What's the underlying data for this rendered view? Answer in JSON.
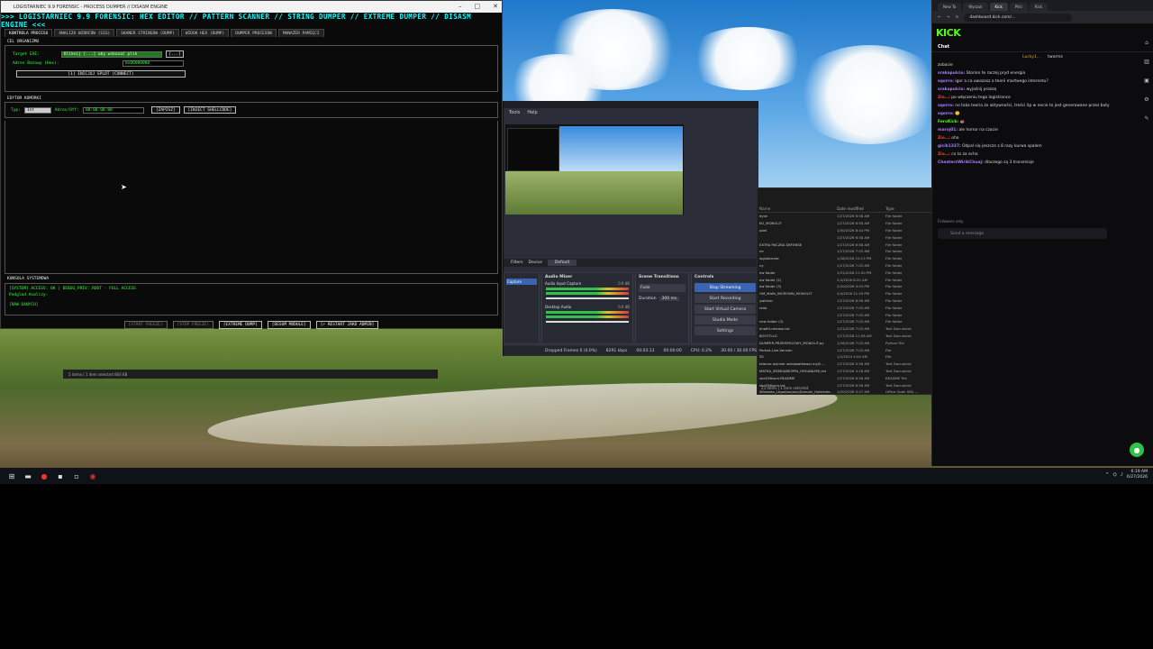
{
  "forensic": {
    "window_title": "LOGISTARNIEC 9.9 FORENSIC - PROCESS DUMPER // DISASM ENGINE",
    "header": ">>> LOGISTARNIEC 9.9 FORENSIC: HEX EDITOR // PATTERN SCANNER // STRING DUMPER // EXTREME DUMPER // DISASM ENGINE <<<",
    "tabs": [
      "KONTROLA PROCESU",
      "ANALIZA WZORCÓW (SIG)",
      "SKANER STRINGÓW (DUMP)",
      "WIDOK HEX (DUMP)",
      "DUMPER PROCESÓW",
      "MANAŻER PAMIĘCI"
    ],
    "target_section": "CEL ORGANIZMU",
    "target_label": "Target EXE:",
    "target_value": "Kliknij [...] aby wskazać plik",
    "browse_btn": "[...]",
    "base_label": "Adres Bazowy (Hex):",
    "base_value": "0x00000000",
    "connect_btn": "[1] INICJUJ SPLOT (CONNECT)",
    "editor_section": "EDYTOR KOMÓRKI",
    "type_label": "Typ:",
    "type_value": "Int",
    "address_label": "Adres/Off:",
    "address_value": "00:00:00:00",
    "write_btn": "[ZAPISZ]",
    "inject_btn": "[INJECT SHELLCODE]",
    "console_section": "KONSOLA SYSTEMOWA",
    "console_lines": [
      "[SYSTEM] ACCESS: OK | DEBUG_PRIV: ROOT - FULL ACCESS",
      "Podglad Analizy:",
      "[RAW DANYCH]"
    ],
    "bottom_buttons": [
      "[START FREEZE]",
      "[STOP FREEZE]",
      "[EXTREME DUMP]",
      "[DESUM MODULE]",
      "[⚡ RESTART JAKO ADMIN]"
    ]
  },
  "obs": {
    "menu": [
      "Tools",
      "Help"
    ],
    "filters": "Filters",
    "device": "Device",
    "default": "Default",
    "mixer_title": "Audio Mixer",
    "mixer_ch1": "Audio Input Capture",
    "mixer_ch2": "Desktop Audio",
    "level1": "0.0 dB",
    "level2": "0.0 dB",
    "transitions_title": "Scene Transitions",
    "transition": "Fade",
    "duration_label": "Duration",
    "duration": "300 ms",
    "controls_title": "Controls",
    "controls": [
      "Stop Streaming",
      "Start Recording",
      "Start Virtual Camera",
      "Studio Mode",
      "Settings"
    ],
    "status": [
      "Dropped Frames 0 (0.0%)",
      "8291 kbps",
      "00:03:13",
      "00:00:00",
      "CPU: 0.2%",
      "30.00 / 30.00 FPS"
    ]
  },
  "files": {
    "headers": [
      "Name",
      "Date modified",
      "Type"
    ],
    "rows": [
      [
        "dysk",
        "1/27/2026 6:58 AM",
        "File folder"
      ],
      [
        "KO_MONOLIT",
        "1/27/2026 6:58 AM",
        "File folder"
      ],
      [
        "ozet",
        "1/30/2026 8:44 PM",
        "File folder"
      ],
      [
        "",
        "1/27/2026 6:58 AM",
        "File folder"
      ],
      [
        "EXTRA PACZKA DEFENSE",
        "1/27/2026 6:58 AM",
        "File folder"
      ],
      [
        "ne",
        "1/27/2026 7:03 AM",
        "File folder"
      ],
      [
        "logistarniec",
        "1/18/2026 10:13 PM",
        "File folder"
      ],
      [
        "ny",
        "1/27/2026 7:03 AM",
        "File folder"
      ],
      [
        "ew folder",
        "1/31/2026 11:50 PM",
        "File folder"
      ],
      [
        "ew folder (2)",
        "2/4/2026 8:20 AM",
        "File folder"
      ],
      [
        "ew folder (3)",
        "2/20/2026 5:03 PM",
        "File folder"
      ],
      [
        "OM_MAIN_INCROWN_MONOLIT",
        "2/4/2026 11:16 PM",
        "File folder"
      ],
      [
        "ywilmer",
        "1/27/2026 6:56 AM",
        "File folder"
      ],
      [
        "rella",
        "1/27/2026 7:03 AM",
        "File folder"
      ],
      [
        "",
        "1/27/2026 7:03 AM",
        "File folder"
      ],
      [
        "new folder (3)",
        "1/27/2026 7:03 AM",
        "File folder"
      ],
      [
        "ima64-release.txt",
        "1/21/2026 7:03 AM",
        "Text Document"
      ],
      [
        "BOOTO.LG",
        "1/17/2026 11:58 AM",
        "Text Document"
      ],
      [
        "DUMPER-PRZEMYSLOWY_MONOLIT.py",
        "1/26/2026 7:03 AM",
        "Python File"
      ],
      [
        "Parted-Live-Version",
        "1/27/2026 7:03 AM",
        "File"
      ],
      [
        "SS",
        "1/1/2024 4:04 AM",
        "File"
      ],
      [
        "telecze wymiar wielowatkowej mylil ...",
        "1/27/2026 5:56 AM",
        "Text Document"
      ],
      [
        "MATKA_ZIEMIA(BEZPIN_ORGANIZM).txt",
        "1/27/2026 4:18 AM",
        "Text Document"
      ],
      [
        "sha256sum.README",
        "1/27/2026 6:56 AM",
        "README File"
      ],
      [
        "sha256sum.txt",
        "1/27/2026 6:56 AM",
        "Text Document"
      ],
      [
        "Windows_LegalizacjanyDomaIn_Holender...",
        "1/20/2026 5:47 AM",
        "Office Open XML ..."
      ]
    ],
    "footer": "23 items  |  1 item selected"
  },
  "explorer_strip": "5 items  |  1 item selected  804 KB",
  "chrome": {
    "tabs": [
      "New Ta",
      "Wyszuk",
      "Kick",
      "Pliki",
      "Kick"
    ],
    "url": "dashboard.kick.com/...",
    "logo": "KICK",
    "chat_title": "Chat",
    "top_users": [
      "Lucky1...",
      "tworms"
    ],
    "messages": [
      {
        "user": "",
        "text": "zobacie",
        "color": "#ccc"
      },
      {
        "user": "srakapulcio:",
        "text": "Storion te raczej pryd energia",
        "color": "#a87ff7"
      },
      {
        "user": "sqorro:",
        "text": "igor a co uwazasz o teorii martwego internetu?",
        "color": "#a87ff7"
      },
      {
        "user": "srakapulcio:",
        "text": "wyjaśnij proszę",
        "color": "#a87ff7"
      },
      {
        "user": "Zio…:",
        "text": "po włączeniu tego logistrance",
        "color": "#e44"
      },
      {
        "user": "sqorro:",
        "text": "no taka teoria że aktywności, treści itp w necie to jest generowane przez boty",
        "color": "#a87ff7"
      },
      {
        "user": "sqorro:",
        "text": "🙂",
        "color": "#a87ff7"
      },
      {
        "user": "FeroKick:",
        "text": "🦔",
        "color": "#53fc18"
      },
      {
        "user": "maroj01:",
        "text": "ale horror na czacie",
        "color": "#a87ff7"
      },
      {
        "user": "Zio…:",
        "text": "oho",
        "color": "#e44"
      },
      {
        "user": "gicik1337:",
        "text": "Odpal się jeszcze z 8 razy kurwa spalem",
        "color": "#a87ff7"
      },
      {
        "user": "Zio…:",
        "text": "co to za echo",
        "color": "#e44"
      },
      {
        "user": "CheaterzWirikChuaj:",
        "text": "dlaczego są 3 transmisje",
        "color": "#a87ff7"
      }
    ],
    "followers_only": "Followers only",
    "send_placeholder": "Send a message"
  },
  "clock": {
    "time": "6:19 AM",
    "date": "6/27/2026"
  }
}
